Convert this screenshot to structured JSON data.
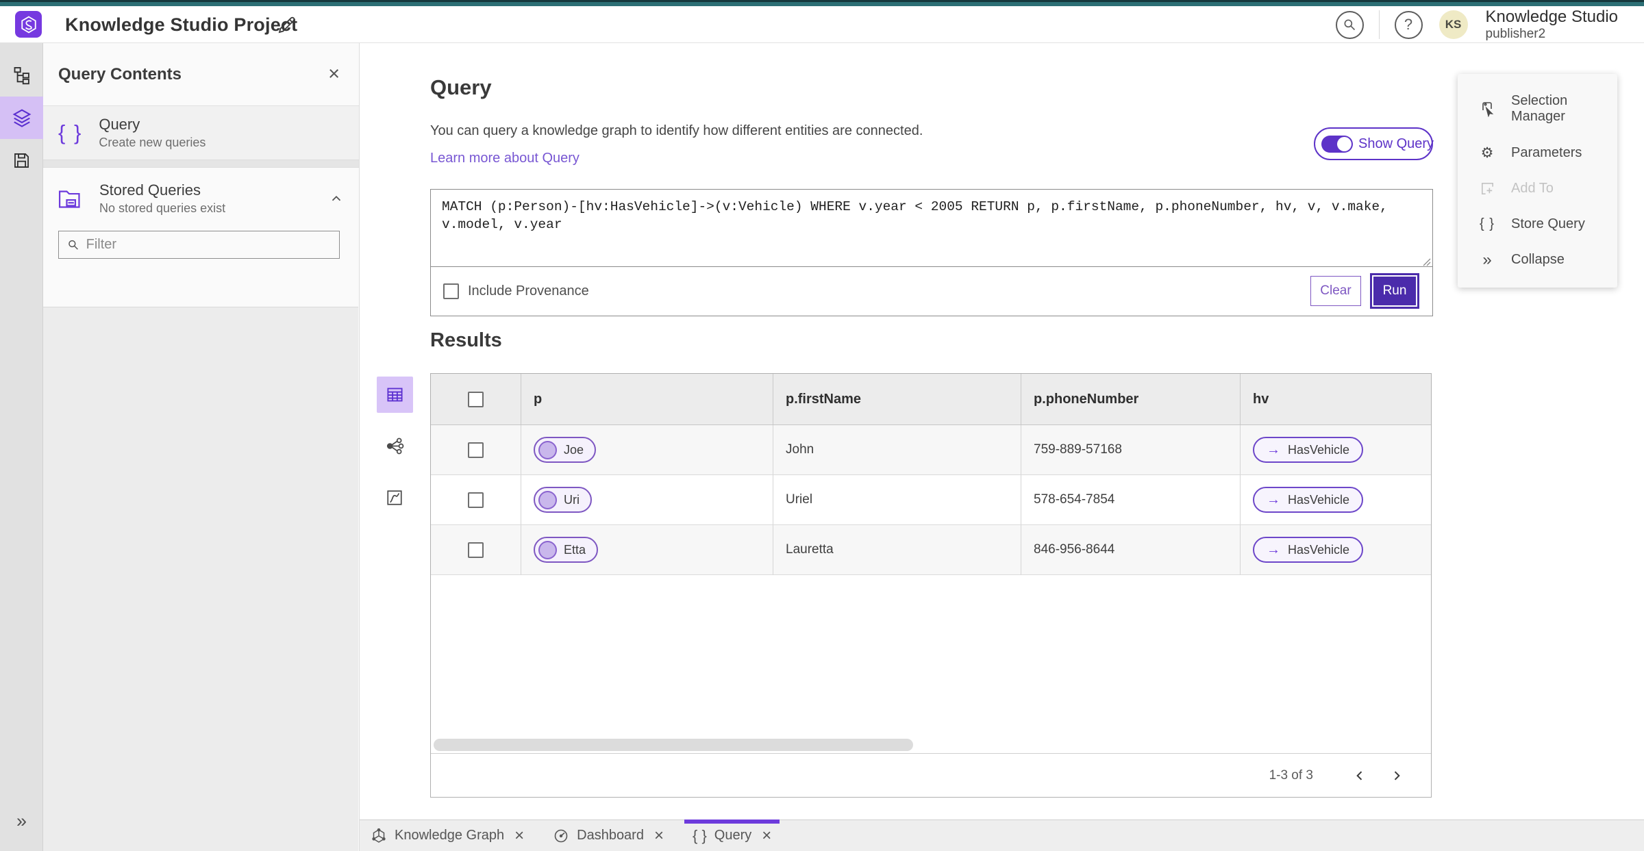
{
  "header": {
    "title": "Knowledge Studio Project",
    "product_name": "Knowledge Studio",
    "username": "publisher2",
    "avatar_initials": "KS",
    "help_glyph": "?"
  },
  "left_panel": {
    "title": "Query Contents",
    "close_icon": "×",
    "query_item": {
      "icon": "{ }",
      "title": "Query",
      "subtitle": "Create new queries"
    },
    "stored_queries": {
      "title": "Stored Queries",
      "subtitle": "No stored queries exist"
    },
    "filter_placeholder": "Filter",
    "expand_icon": "»"
  },
  "query_section": {
    "heading": "Query",
    "description": "You can query a knowledge graph to identify how different entities are connected.",
    "link": "Learn more about Query",
    "toggle_label": "Show Query",
    "query_text": "MATCH (p:Person)-[hv:HasVehicle]->(v:Vehicle) WHERE v.year < 2005 RETURN p, p.firstName, p.phoneNumber, hv, v, v.make, v.model, v.year",
    "checkbox_label": "Include Provenance",
    "clear_label": "Clear",
    "run_label": "Run"
  },
  "results": {
    "heading": "Results",
    "columns": [
      "p",
      "p.firstName",
      "p.phoneNumber",
      "hv"
    ],
    "hv_arrow": "→",
    "rows": [
      {
        "p": "Joe",
        "firstName": "John",
        "phoneNumber": "759-889-57168",
        "hv": "HasVehicle"
      },
      {
        "p": "Uri",
        "firstName": "Uriel",
        "phoneNumber": "578-654-7854",
        "hv": "HasVehicle"
      },
      {
        "p": "Etta",
        "firstName": "Lauretta",
        "phoneNumber": "846-956-8644",
        "hv": "HasVehicle"
      }
    ],
    "pagination": {
      "label": "1-3 of 3"
    }
  },
  "right_menu": {
    "items": [
      {
        "label": "Selection Manager"
      },
      {
        "label": "Parameters",
        "icon_glyph": "⚙"
      },
      {
        "label": "Add To"
      },
      {
        "label": "Store Query",
        "icon_glyph": "{ }"
      },
      {
        "label": "Collapse",
        "icon_glyph": "»"
      }
    ]
  },
  "tabs": [
    {
      "label": "Knowledge Graph",
      "close": "×"
    },
    {
      "label": "Dashboard",
      "close": "×"
    },
    {
      "label": "Query",
      "close": "×",
      "icon_glyph": "{ }"
    }
  ],
  "colors": {
    "accent": "#6d3bdc",
    "run_button": "#4b2bab",
    "top_strip": "#2c6f75",
    "rail_selected": "#d5c0f5"
  }
}
